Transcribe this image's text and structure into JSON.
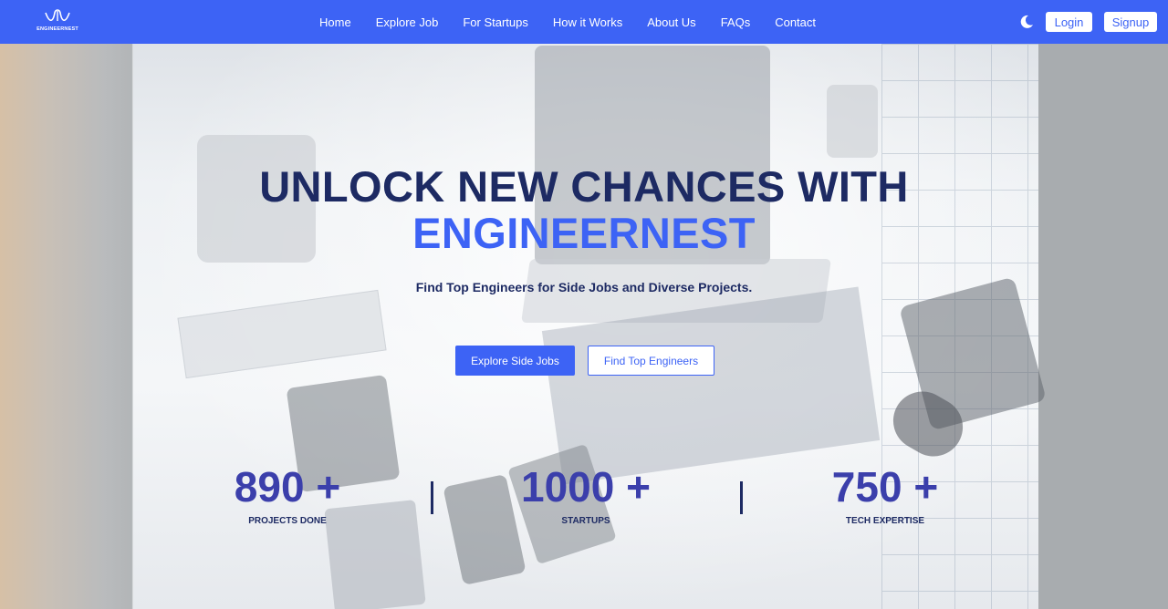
{
  "brand": {
    "name": "ENGINEERNEST"
  },
  "nav": {
    "links": [
      "Home",
      "Explore Job",
      "For Startups",
      "How it Works",
      "About Us",
      "FAQs",
      "Contact"
    ],
    "login": "Login",
    "signup": "Signup",
    "theme_icon": "moon-icon"
  },
  "hero": {
    "title_line1": "UNLOCK NEW CHANCES WITH",
    "title_line2": "ENGINEERNEST",
    "subtitle": "Find Top Engineers for Side Jobs and Diverse Projects.",
    "primary_button": "Explore Side Jobs",
    "secondary_button": "Find Top Engineers"
  },
  "stats": [
    {
      "value": "890 +",
      "label": "PROJECTS DONE"
    },
    {
      "value": "1000 +",
      "label": "STARTUPS"
    },
    {
      "value": "750 +",
      "label": "TECH EXPERTISE"
    }
  ],
  "colors": {
    "primary": "#3d63f5",
    "navy": "#1d2a63",
    "stat": "#3b3fab"
  }
}
